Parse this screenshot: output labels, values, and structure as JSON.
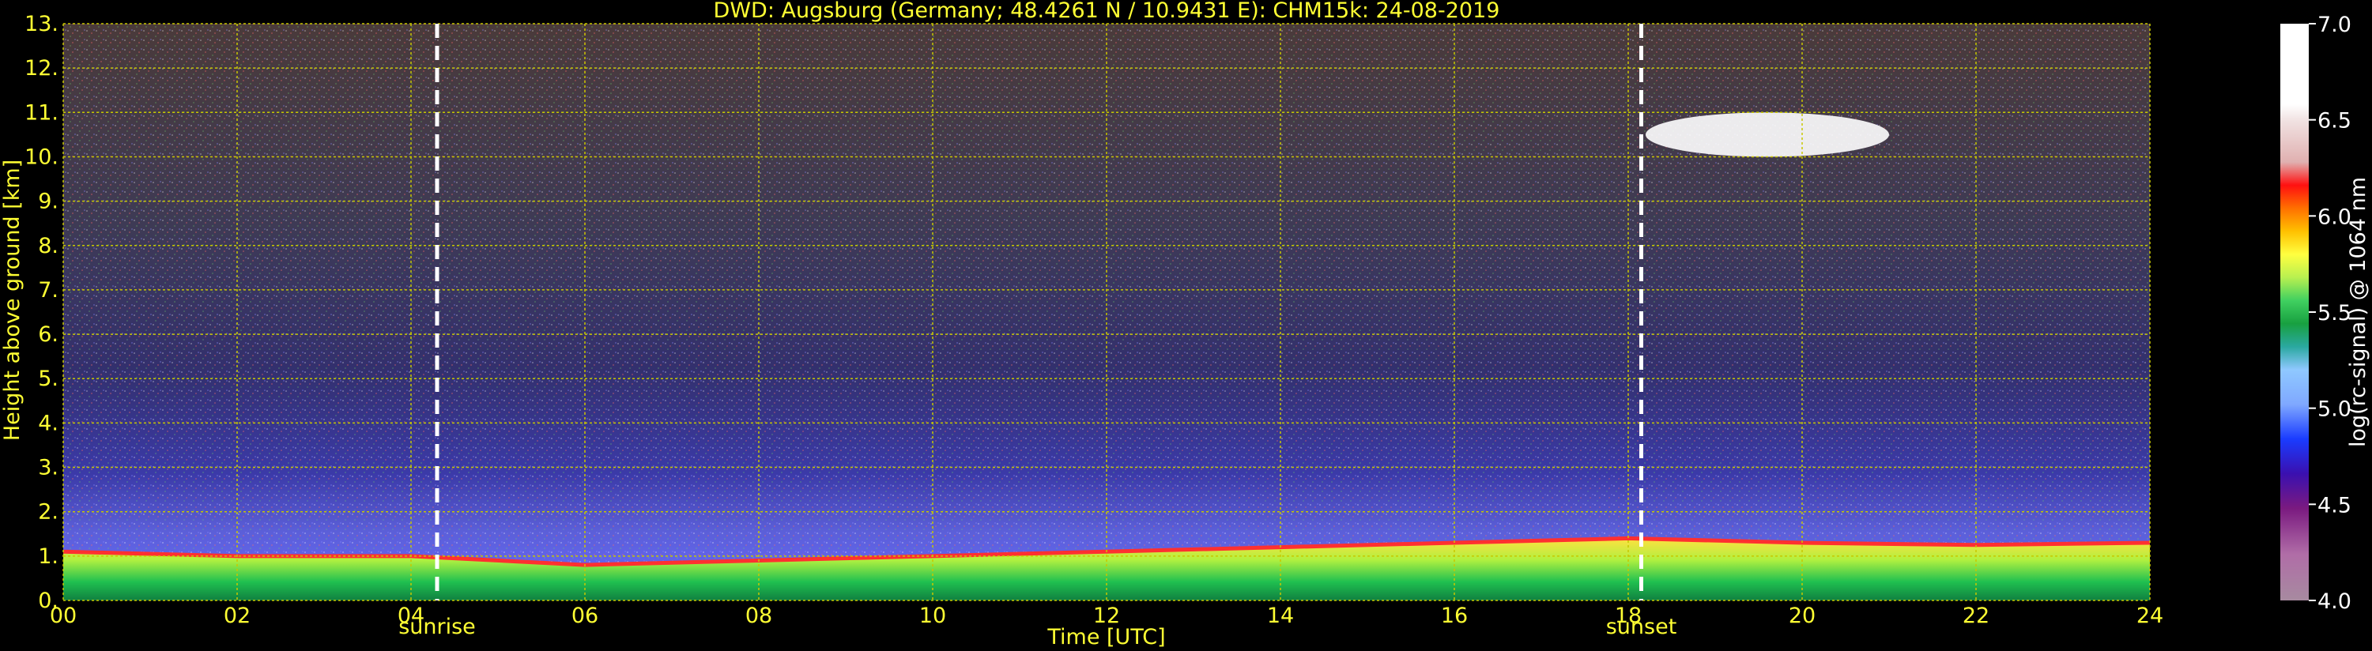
{
  "chart_data": {
    "type": "heatmap",
    "title": "DWD: Augsburg (Germany; 48.4261 N / 10.9431 E):    CHM15k: 24-08-2019",
    "xlabel": "Time [UTC]",
    "ylabel": "Height above ground [km]",
    "x_ticks": [
      "00",
      "02",
      "04",
      "06",
      "08",
      "10",
      "12",
      "14",
      "16",
      "18",
      "20",
      "22",
      "24"
    ],
    "x_range": [
      0,
      24
    ],
    "y_ticks": [
      "0.",
      "1.",
      "2.",
      "3.",
      "4.",
      "5.",
      "6.",
      "7.",
      "8.",
      "9.",
      "10.",
      "11.",
      "12.",
      "13."
    ],
    "y_range": [
      0,
      13
    ],
    "grid": true,
    "events": [
      {
        "label": "sunrise",
        "time": 4.3
      },
      {
        "label": "sunset",
        "time": 18.15
      }
    ],
    "colorbar": {
      "label": "log(rc-signal) @ 1064 nm",
      "ticks": [
        "4.0",
        "4.5",
        "5.0",
        "5.5",
        "6.0",
        "6.5",
        "7.0"
      ],
      "range": [
        4.0,
        7.0
      ]
    },
    "features": [
      {
        "name": "boundary layer top (km)",
        "times": [
          0,
          2,
          4,
          6,
          8,
          10,
          12,
          14,
          16,
          18,
          20,
          22,
          24
        ],
        "heights": [
          1.1,
          1.0,
          1.0,
          0.8,
          0.9,
          1.0,
          1.1,
          1.2,
          1.3,
          1.4,
          1.3,
          1.25,
          1.3
        ]
      },
      {
        "name": "cirrus cloud (km)",
        "time_range": [
          18.2,
          21.0
        ],
        "height_range": [
          10.0,
          11.0
        ]
      }
    ]
  },
  "colors": {
    "axis_text": "#ffff33",
    "grid": "#c8c800",
    "event_line": "#ffffff"
  }
}
